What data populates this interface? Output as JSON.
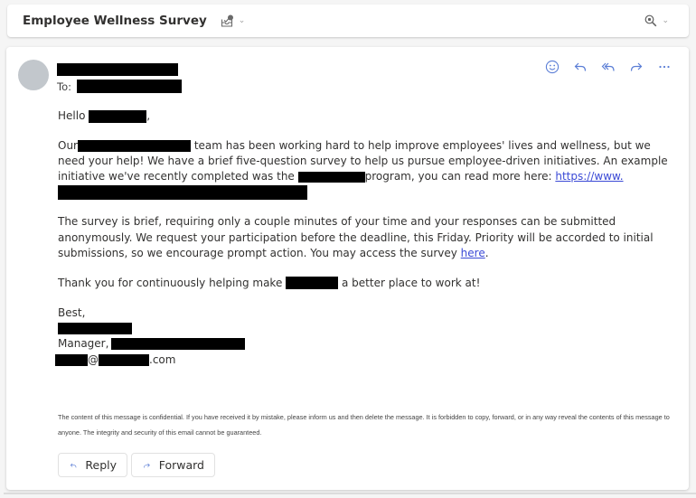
{
  "header": {
    "subject": "Employee Wellness Survey",
    "icons": [
      "tag-icon",
      "chevron-down-icon",
      "zoom-icon",
      "chevron-down-icon"
    ]
  },
  "message": {
    "sender_name": "[redacted]",
    "to_label": "To:",
    "to_value": "[redacted]",
    "actions": [
      "emoji-icon",
      "reply-icon",
      "reply-all-icon",
      "forward-icon",
      "more-icon"
    ],
    "greeting_prefix": "Hello",
    "greeting_suffix": ",",
    "p1": {
      "a": "Our",
      "b": "team has been working hard to help improve employees' lives and wellness, but we need your help! We have a brief five-question survey to help us pursue employee-driven initiatives. An example initiative we've recently completed was the",
      "c": "program, you can read more here:",
      "link": "https://www."
    },
    "p2": {
      "text": "The survey is brief, requiring only a couple minutes of your time and your responses can be submitted anonymously. We request your participation before the deadline, this Friday. Priority will be accorded to initial submissions, so we encourage prompt action. You may access the survey",
      "link": "here",
      "end": "."
    },
    "p3": {
      "a": "Thank you for continuously helping make",
      "b": "a better place to work at!"
    },
    "signoff": "Best,",
    "title_prefix": "Manager,",
    "email_at": "@",
    "email_suffix": ".com",
    "disclaimer": "The content of this message is confidential. If you have received it by mistake, please inform us and then delete the message. It is forbidden to copy, forward, or in any way reveal the contents of this message to anyone. The integrity and security of this email cannot be guaranteed."
  },
  "buttons": {
    "reply": "Reply",
    "forward": "Forward"
  },
  "colors": {
    "link": "#3b4ad6",
    "icon_accent": "#5b7ed6",
    "redaction": "#000000"
  }
}
